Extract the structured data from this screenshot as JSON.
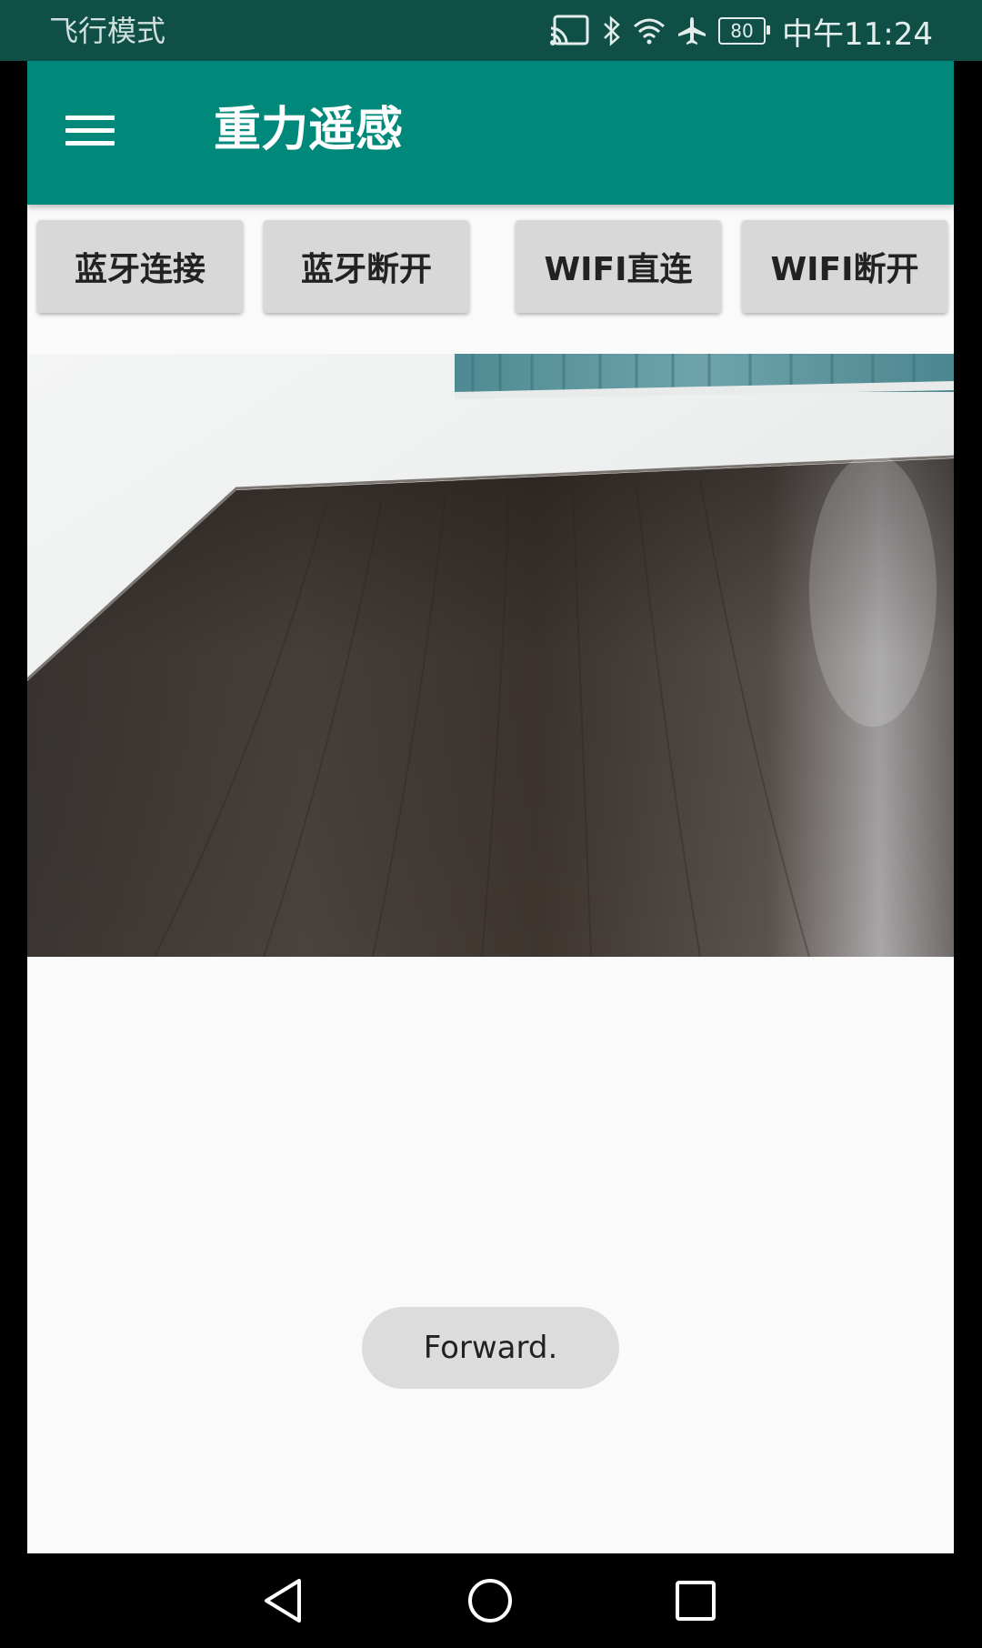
{
  "status_bar": {
    "mode_text": "飞行模式",
    "battery_level": "80",
    "time": "中午11:24",
    "icons": [
      "cast-icon",
      "bluetooth-icon",
      "wifi-icon",
      "airplane-icon",
      "battery-icon"
    ]
  },
  "toolbar": {
    "menu_icon": "hamburger-menu-icon",
    "title": "重力遥感",
    "color": "#00897b"
  },
  "buttons": {
    "bt_connect": "蓝牙连接",
    "bt_disconnect": "蓝牙断开",
    "wifi_connect": "WIFI直连",
    "wifi_disconnect": "WIFI断开"
  },
  "camera": {
    "description_icon": "camera-feed"
  },
  "toast": {
    "text": "Forward."
  },
  "nav_bar": {
    "icons": [
      "back-icon",
      "home-icon",
      "recents-icon"
    ]
  }
}
